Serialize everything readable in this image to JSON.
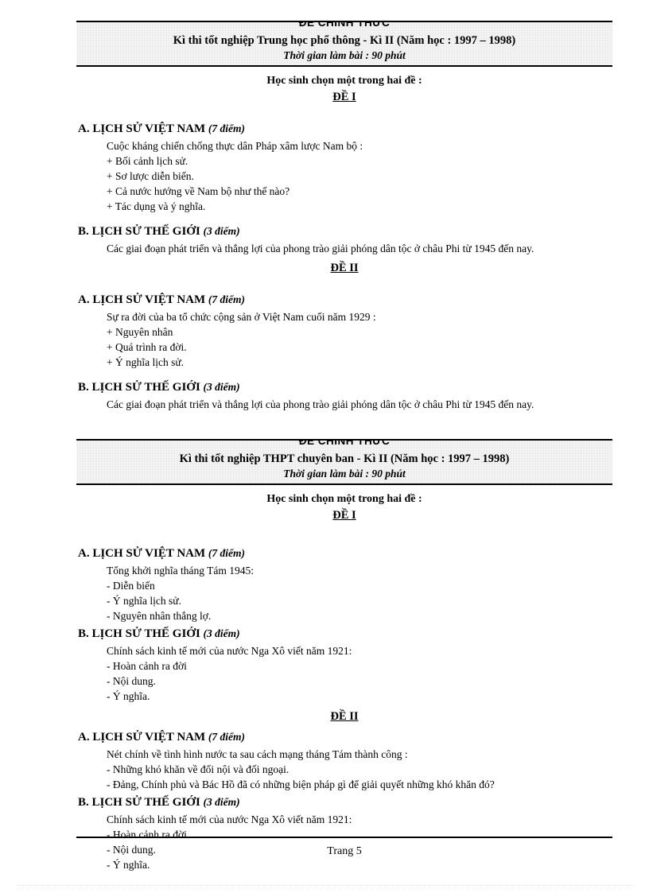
{
  "document": {
    "page_label": "Trang 5"
  },
  "exams": [
    {
      "official_stamp": "ĐỀ CHÍNH THỨC",
      "title": "Kì thi tốt nghiệp  Trung  học phổ thông - Kì II (Năm học :  1997 – 1998)",
      "duration": "Thời gian làm bài : 90 phút",
      "instruction": "Học sinh chọn một trong hai đề :",
      "topics": [
        {
          "label": "ĐỀ I",
          "sections": [
            {
              "heading": "A. LỊCH SỬ VIỆT NAM",
              "points": "(7 điểm)",
              "lead": "Cuộc kháng  chiến  chống thực dân Pháp xâm lược Nam bộ :",
              "items": [
                "+ Bối cảnh lịch  sử.",
                "+ Sơ lược diễn  biến.",
                "+ Cả nước hướng  về Nam bộ như thế  nào?",
                "+ Tác dụng và ý nghĩa."
              ]
            },
            {
              "heading": "B. LỊCH SỬ THẾ GIỚI",
              "points": "(3 điểm)",
              "lead": "Các giai  đoạn phát triển  và thắng  lợi  của phong  trào giải  phóng  dân tộc ở châu Phi từ  1945 đến nay.",
              "items": []
            }
          ]
        },
        {
          "label": "ĐỀ II",
          "sections": [
            {
              "heading": "A. LỊCH SỬ VIỆT NAM",
              "points": "(7 điểm)",
              "lead": "Sự ra đời của ba tổ chức cộng sản ở Việt  Nam cuối năm  1929 :",
              "items": [
                "+ Nguyên  nhân",
                "+ Quá trình  ra đời.",
                "+  Ý nghĩa  lịch  sử."
              ]
            },
            {
              "heading": "B. LỊCH SỬ THẾ GIỚI",
              "points": "(3 điểm)",
              "lead": "Các giai  đoạn phát triển  và thắng  lợi  của phong  trào giải  phóng  dân tộc ở châu Phi từ 1945 đến nay.",
              "items": []
            }
          ]
        }
      ]
    },
    {
      "official_stamp": "ĐỀ CHÍNH THỨC",
      "title": "Kì thi tốt nghiệp  THPT  chuyên ban - Kì II (Năm học :  1997 – 1998)",
      "duration": "Thời gian làm bài : 90 phút",
      "instruction": "Học sinh chọn một trong hai đề :",
      "topics": [
        {
          "label": "ĐỀ I",
          "sections": [
            {
              "heading": "A. LỊCH SỬ VIỆT NAM",
              "points": "(7 điểm)",
              "lead": "Tổng khởi nghĩa tháng  Tám 1945:",
              "items": [
                "- Diễn biến",
                "- Ý nghĩa  lịch  sử.",
                "- Nguyên  nhân thắng  lợ."
              ]
            },
            {
              "heading": "B. LỊCH SỬ THẾ GIỚI",
              "points": "(3 điểm)",
              "lead": "Chính  sách kinh tế mới của nước Nga Xô viết năm  1921:",
              "items": [
                "- Hoàn cảnh ra đời",
                "- Nội dung.",
                "- Ý nghĩa."
              ]
            }
          ]
        },
        {
          "label": "ĐỀ II",
          "sections": [
            {
              "heading": "A. LỊCH SỬ VIỆT NAM",
              "points": "(7 điểm)",
              "lead": "Nét chính  về tình  hình  nước ta sau cách mạng  tháng  Tám thành  công :",
              "items": [
                "-  Những  khó khăn về đối nội và đối ngoại.",
                "-  Đảng,  Chính  phủ và Bác Hồ đã có những  biện pháp gì để giải  quyết những  khó khăn đó?"
              ]
            },
            {
              "heading": "B. LỊCH SỬ THẾ GIỚI",
              "points": "(3 điểm)",
              "lead": "Chính  sách kinh tế mới của nước Nga Xô viết năm  1921:",
              "items": [
                "- Hoàn cảnh ra đời",
                "- Nội dung.",
                "- Ý nghĩa."
              ]
            }
          ]
        }
      ]
    }
  ]
}
